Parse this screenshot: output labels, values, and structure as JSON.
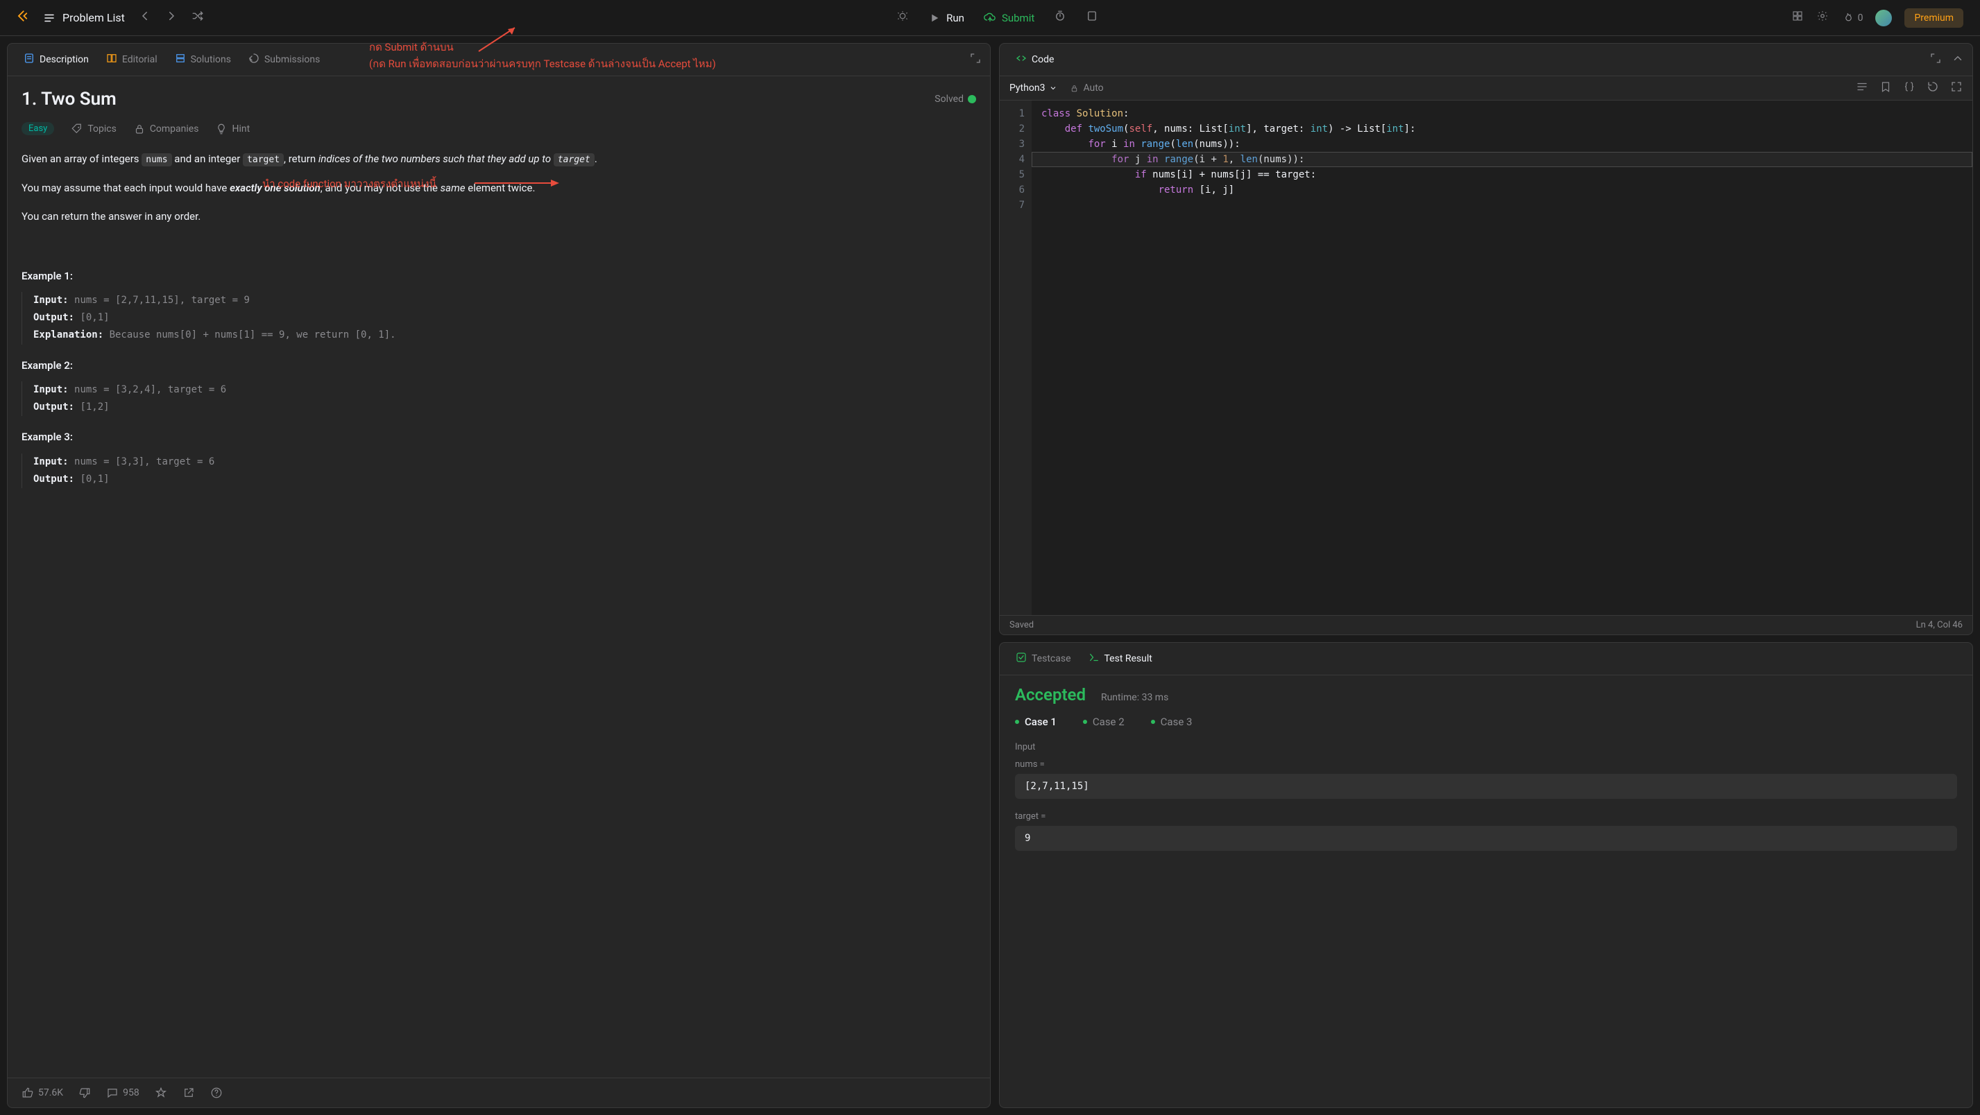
{
  "topbar": {
    "problem_list": "Problem List",
    "run": "Run",
    "submit": "Submit",
    "streak": "0",
    "premium": "Premium"
  },
  "description_tabs": {
    "description": "Description",
    "editorial": "Editorial",
    "solutions": "Solutions",
    "submissions": "Submissions"
  },
  "problem": {
    "title": "1. Two Sum",
    "solved_label": "Solved",
    "difficulty": "Easy",
    "topics": "Topics",
    "companies": "Companies",
    "hint": "Hint",
    "para1_pre": "Given an array of integers ",
    "para1_code1": "nums",
    "para1_mid1": " and an integer ",
    "para1_code2": "target",
    "para1_mid2": ", return ",
    "para1_em": "indices of the two numbers such that they add up to ",
    "para1_code3": "target",
    "para1_end": ".",
    "para2_pre": "You may assume that each input would have ",
    "para2_strong": "exactly one solution",
    "para2_mid": ", and you may not use the ",
    "para2_em": "same",
    "para2_end": " element twice.",
    "para3": "You can return the answer in any order.",
    "ex1_title": "Example 1:",
    "ex1_input_lbl": "Input: ",
    "ex1_input": "nums = [2,7,11,15], target = 9",
    "ex1_output_lbl": "Output: ",
    "ex1_output": "[0,1]",
    "ex1_expl_lbl": "Explanation: ",
    "ex1_expl": "Because nums[0] + nums[1] == 9, we return [0, 1].",
    "ex2_title": "Example 2:",
    "ex2_input": "nums = [3,2,4], target = 6",
    "ex2_output": "[1,2]",
    "ex3_title": "Example 3:",
    "ex3_input": "nums = [3,3], target = 6",
    "ex3_output": "[0,1]"
  },
  "footer": {
    "likes": "57.6K",
    "comments": "958"
  },
  "code": {
    "header": "Code",
    "language": "Python3",
    "auto": "Auto",
    "lines": [
      "class Solution:",
      "    def twoSum(self, nums: List[int], target: int) -> List[int]:",
      "        for i in range(len(nums)):",
      "            for j in range(i + 1, len(nums)):",
      "                if nums[i] + nums[j] == target:",
      "                    return [i, j]",
      ""
    ],
    "saved": "Saved",
    "cursor": "Ln 4, Col 46"
  },
  "result": {
    "testcase_tab": "Testcase",
    "result_tab": "Test Result",
    "status": "Accepted",
    "runtime_lbl": "Runtime: ",
    "runtime_val": "33 ms",
    "cases": [
      "Case 1",
      "Case 2",
      "Case 3"
    ],
    "input_label": "Input",
    "var1_name": "nums =",
    "var1_val": "[2,7,11,15]",
    "var2_name": "target =",
    "var2_val": "9"
  },
  "annotations": {
    "submit_line1": "กด Submit ด้านบน",
    "submit_line2": "(กด Run เพื่อทดสอบก่อนว่าผ่านครบทุก Testcase ด้านล่างจนเป็น Accept ไหม)",
    "code_note": "นำ code function มาวางตรงตำแหน่งนี้"
  }
}
